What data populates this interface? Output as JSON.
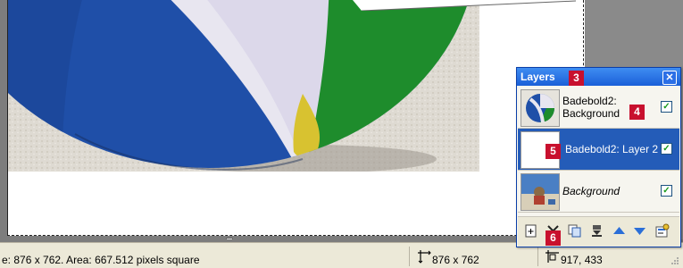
{
  "status_bar": {
    "size_area_text": "e: 876 x 762. Area: 667.512 pixels square",
    "dimensions_text": "876 x 762",
    "cursor_text": "917, 433"
  },
  "layers_panel": {
    "title": "Layers",
    "close_glyph": "✕",
    "layers": [
      {
        "name_line1": "Badebold2:",
        "name_line2": "Background",
        "visible": true,
        "selected": false,
        "italic": false
      },
      {
        "name_line1": "Badebold2: Layer 2",
        "name_line2": "",
        "visible": true,
        "selected": true,
        "italic": false
      },
      {
        "name_line1": "Background",
        "name_line2": "",
        "visible": true,
        "selected": false,
        "italic": true
      }
    ],
    "checkbox_glyph": "✓",
    "tools": [
      "new-layer-icon",
      "delete-layer-icon",
      "duplicate-layer-icon",
      "merge-layer-icon",
      "move-layer-up-icon",
      "move-layer-down-icon",
      "layer-properties-icon"
    ]
  },
  "callouts": {
    "n3": "3",
    "n4": "4",
    "n5": "5",
    "n6": "6"
  },
  "colors": {
    "callout_red": "#c8102e",
    "title_blue": "#1a5fd8",
    "selected_row": "#245cb8",
    "ball_blue": "#1f4fa8",
    "ball_green": "#1e8c2c"
  }
}
